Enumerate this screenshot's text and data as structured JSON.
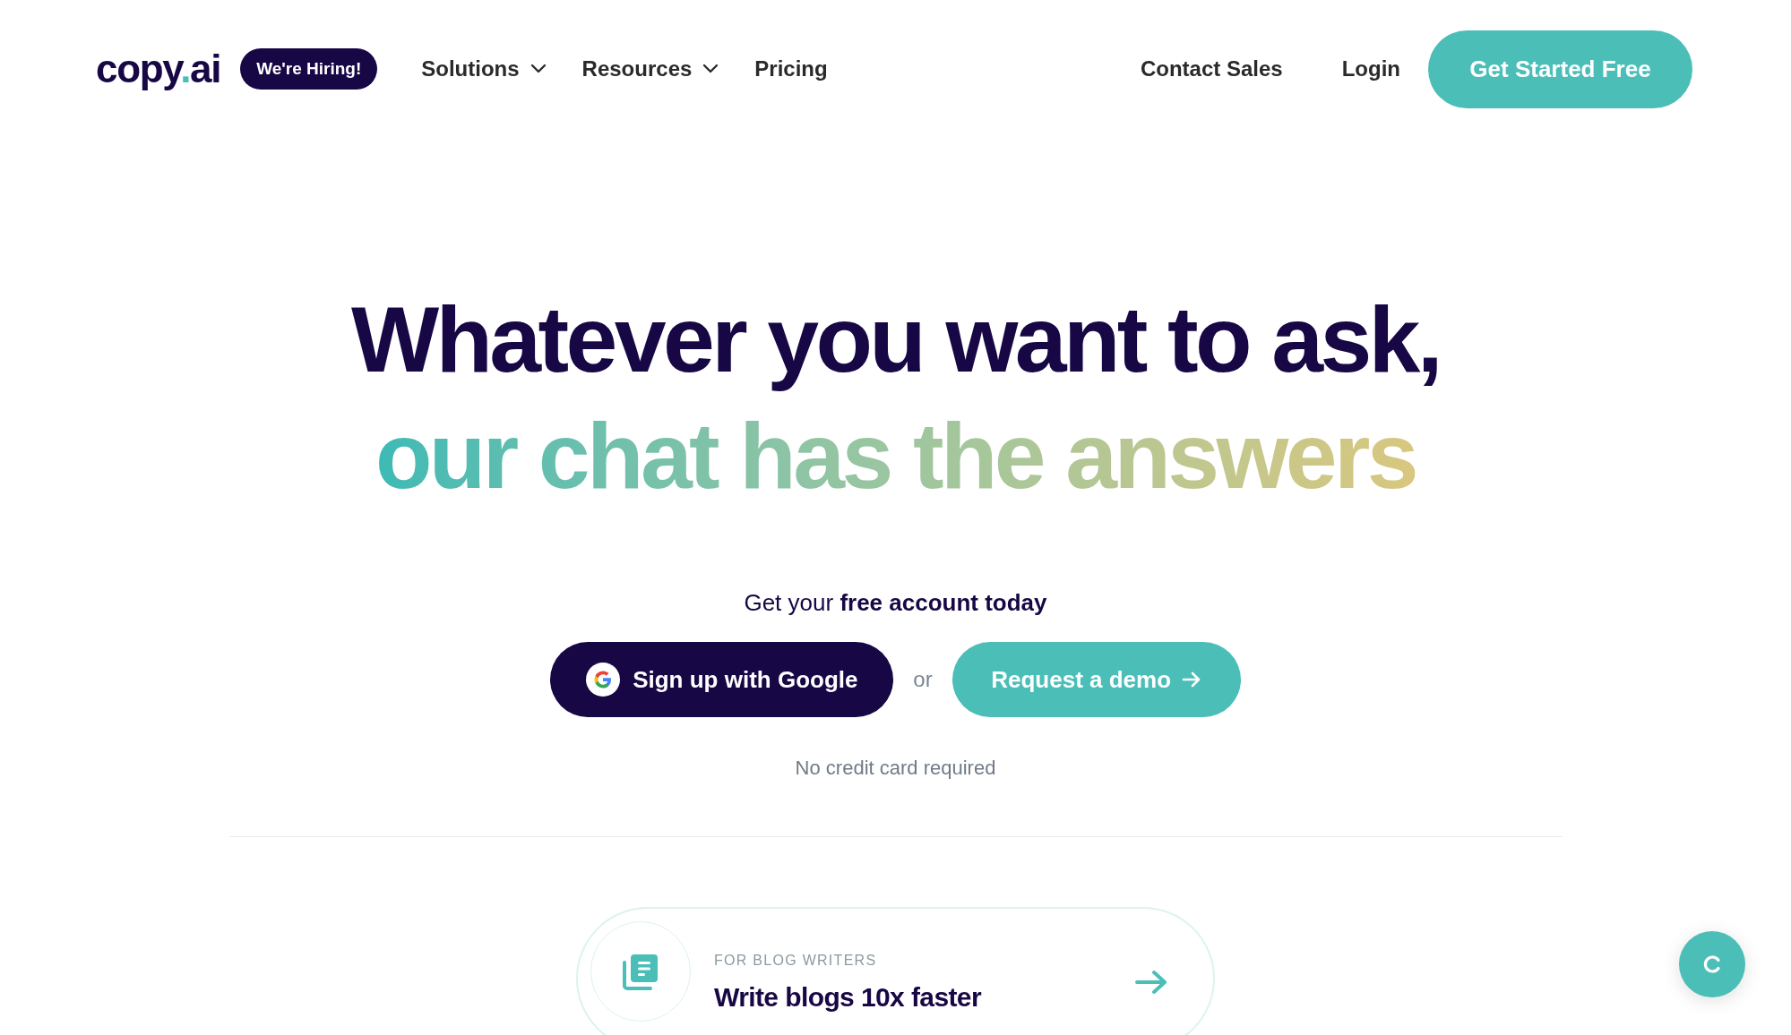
{
  "header": {
    "logo_parts": [
      "copy",
      ".",
      "ai"
    ],
    "hiring_badge": "We're Hiring!",
    "nav": [
      {
        "label": "Solutions",
        "kind": "dropdown"
      },
      {
        "label": "Resources",
        "kind": "dropdown"
      },
      {
        "label": "Pricing",
        "kind": "link"
      }
    ],
    "contact_sales": "Contact Sales",
    "login": "Login",
    "cta": "Get Started Free"
  },
  "hero": {
    "heading_line_1": "Whatever you want to ask,",
    "heading_line_2": "our chat has the answers",
    "subtitle": "Get your **free account today**",
    "google_button": "Sign up with Google",
    "or": "or",
    "demo_button": "Request a demo",
    "note": "No credit card required"
  },
  "feature_card": {
    "eyebrow": "FOR BLOG WRITERS",
    "title": "Write blogs 10x faster"
  }
}
